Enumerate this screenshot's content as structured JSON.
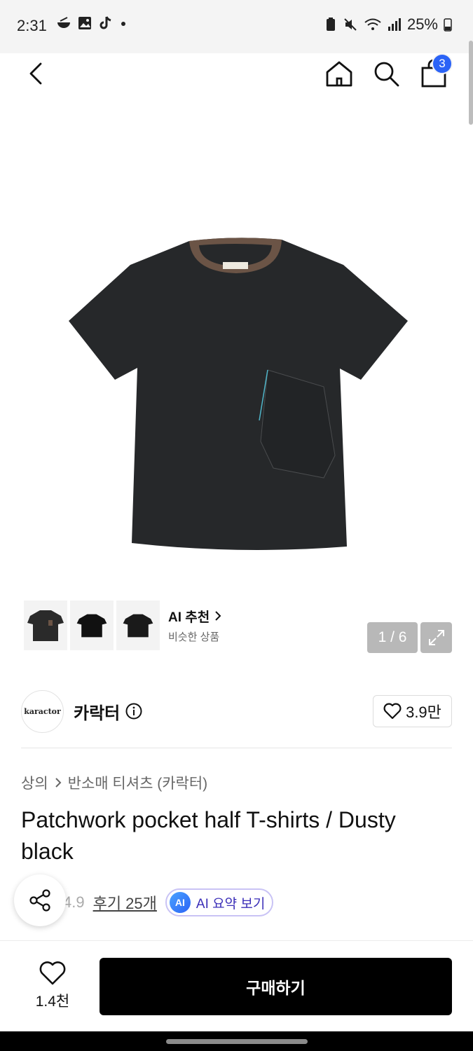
{
  "status_bar": {
    "time": "2:31",
    "battery": "25%"
  },
  "nav": {
    "cart_count": "3"
  },
  "gallery": {
    "page_indicator": "1 / 6",
    "ai_card": {
      "title": "AI 추천",
      "subtitle": "비슷한 상품"
    }
  },
  "brand": {
    "logo_text": "karactor",
    "name": "카락터",
    "likes": "3.9만"
  },
  "breadcrumb": {
    "category": "상의",
    "subcategory": "반소매 티셔츠 (카락터)"
  },
  "product": {
    "title": "Patchwork pocket half T-shirts / Dusty black"
  },
  "reviews": {
    "rating_partial": "4.9",
    "link": "후기 25개",
    "ai_badge": "AI",
    "ai_summary": "AI 요약 보기"
  },
  "bottom_bar": {
    "wish_count": "1.4천",
    "buy_label": "구매하기"
  },
  "colors": {
    "accent_blue": "#2b63f6",
    "buy_button": "#000000",
    "ai_purple": "#3b2fb8"
  }
}
